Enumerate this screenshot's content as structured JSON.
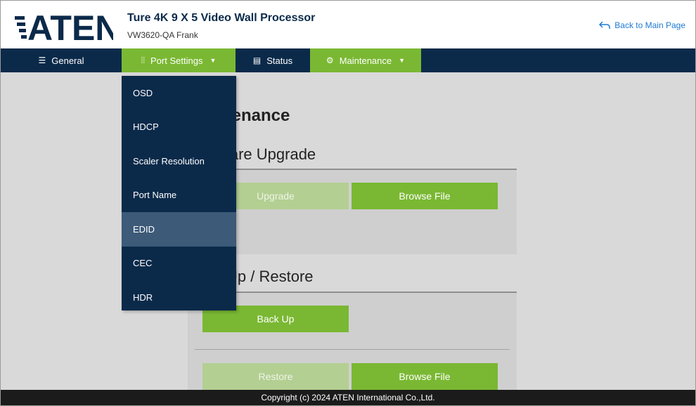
{
  "header": {
    "logo_text": "ATEN",
    "title": "Ture 4K 9 X 5 Video Wall Processor",
    "subtitle": "VW3620-QA Frank",
    "back_link": "Back to Main Page"
  },
  "nav": {
    "items": [
      {
        "label": "General",
        "icon": "list-icon"
      },
      {
        "label": "Port Settings",
        "icon": "port-icon",
        "active": true
      },
      {
        "label": "Status",
        "icon": "status-icon"
      },
      {
        "label": "Maintenance",
        "icon": "gear-icon",
        "active": true
      }
    ]
  },
  "dropdown": {
    "items": [
      {
        "label": "OSD"
      },
      {
        "label": "HDCP"
      },
      {
        "label": "Scaler Resolution"
      },
      {
        "label": "Port Name"
      },
      {
        "label": "EDID",
        "highlighted": true
      },
      {
        "label": "CEC"
      },
      {
        "label": "HDR"
      }
    ]
  },
  "main": {
    "heading": "Maintenance",
    "firmware": {
      "title": "Firmware Upgrade",
      "upgrade_button": "Upgrade",
      "browse_button": "Browse File"
    },
    "backup": {
      "title": "Back Up / Restore",
      "backup_button": "Back Up",
      "restore_button": "Restore",
      "browse_button": "Browse File"
    }
  },
  "footer": {
    "copyright": "Copyright (c) 2024 ATEN International Co.,Ltd."
  },
  "colors": {
    "navy": "#0b2a4a",
    "green": "#7ab833",
    "green_disabled": "#b3cf92",
    "link_blue": "#1e7bd4",
    "dropdown_highlight": "#3d5a78"
  }
}
